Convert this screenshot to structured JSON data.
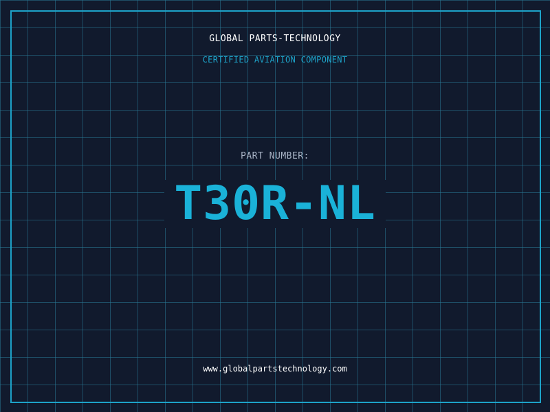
{
  "header": {
    "company_name": "GLOBAL PARTS-TECHNOLOGY",
    "subtitle": "CERTIFIED AVIATION COMPONENT"
  },
  "part": {
    "label": "PART NUMBER:",
    "number": "T30R-NL"
  },
  "footer": {
    "website": "www.globalpartstechnology.com"
  },
  "colors": {
    "background": "#111a2d",
    "grid": "#287896",
    "frame": "#1da3c9",
    "accent": "#1ab2d8",
    "label": "#a9b4c6",
    "text": "#ffffff"
  }
}
